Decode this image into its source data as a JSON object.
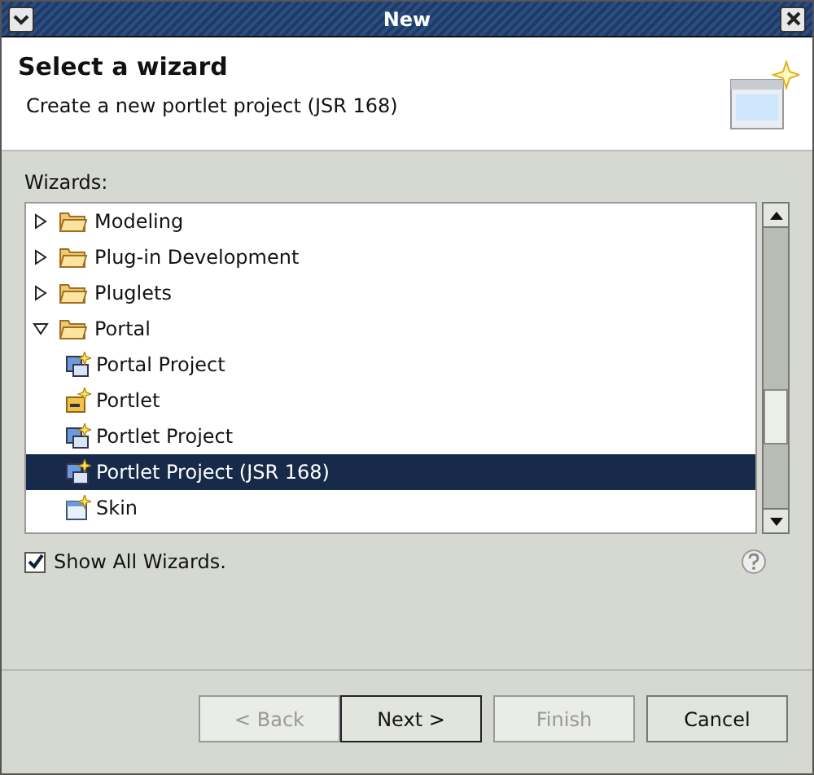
{
  "window": {
    "title": "New"
  },
  "header": {
    "title": "Select a wizard",
    "description": "Create a new portlet project (JSR 168)"
  },
  "wizards_label": "Wizards:",
  "tree": [
    {
      "label": "Modeling",
      "kind": "folder",
      "expanded": false,
      "selected": false
    },
    {
      "label": "Plug-in Development",
      "kind": "folder",
      "expanded": false,
      "selected": false
    },
    {
      "label": "Pluglets",
      "kind": "folder",
      "expanded": false,
      "selected": false
    },
    {
      "label": "Portal",
      "kind": "folder",
      "expanded": true,
      "selected": false,
      "children": [
        {
          "label": "Portal Project",
          "kind": "project",
          "selected": false
        },
        {
          "label": "Portlet",
          "kind": "portlet",
          "selected": false
        },
        {
          "label": "Portlet Project",
          "kind": "project",
          "selected": false
        },
        {
          "label": "Portlet Project (JSR 168)",
          "kind": "project",
          "selected": true
        },
        {
          "label": "Skin",
          "kind": "skin",
          "selected": false
        }
      ]
    }
  ],
  "show_all": {
    "label": "Show All Wizards.",
    "checked": true
  },
  "buttons": [
    {
      "label": "< Back",
      "disabled": true,
      "default": false
    },
    {
      "label": "Next >",
      "disabled": false,
      "default": true
    },
    {
      "label": "Finish",
      "disabled": true,
      "default": false
    },
    {
      "label": "Cancel",
      "disabled": false,
      "default": false
    }
  ]
}
